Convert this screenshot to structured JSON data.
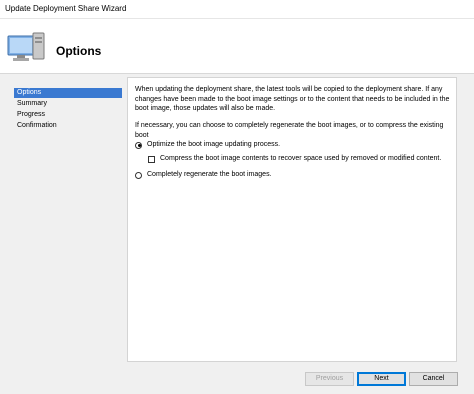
{
  "window": {
    "title": "Update Deployment Share Wizard"
  },
  "header": {
    "title": "Options",
    "icon": "computer-icon"
  },
  "nav": {
    "items": [
      {
        "label": "Options",
        "selected": true
      },
      {
        "label": "Summary",
        "selected": false
      },
      {
        "label": "Progress",
        "selected": false
      },
      {
        "label": "Confirmation",
        "selected": false
      }
    ]
  },
  "content": {
    "description": "When updating the deployment share, the latest tools will be copied to the deployment share.  If any changes have been made to the boot image settings or to the content that needs to be included in the boot image, those updates will also be made.",
    "regen_note": "If necessary, you can choose to completely regenerate the boot images, or to compress the existing boot",
    "option_optimize": {
      "label": "Optimize the boot image updating process.",
      "selected": true
    },
    "option_compress": {
      "label": "Compress the boot image contents to recover space used by removed or modified content.",
      "checked": false
    },
    "option_regenerate": {
      "label": "Completely regenerate the boot images.",
      "selected": false
    }
  },
  "buttons": {
    "previous": {
      "label": "Previous",
      "enabled": false
    },
    "next": {
      "label": "Next",
      "enabled": true
    },
    "cancel": {
      "label": "Cancel",
      "enabled": true
    }
  },
  "colors": {
    "selection": "#3a79d1",
    "default_button_border": "#0078d7"
  }
}
